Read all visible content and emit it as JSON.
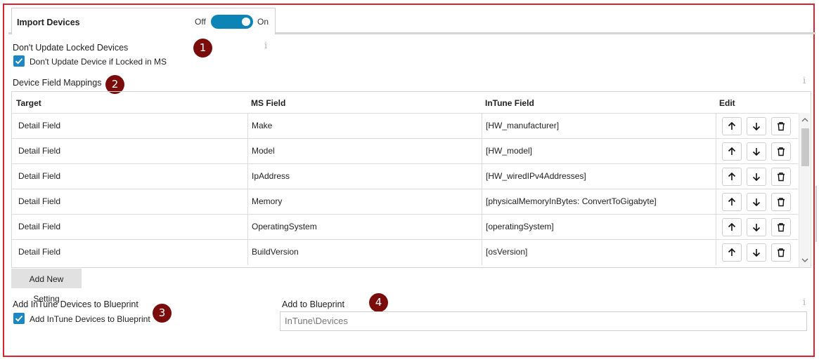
{
  "tab": {
    "title": "Import Devices",
    "toggle_off": "Off",
    "toggle_on": "On"
  },
  "locked": {
    "heading": "Don't Update Locked Devices",
    "checkbox_label": "Don't Update Device if Locked in MS"
  },
  "mappings": {
    "heading": "Device Field Mappings",
    "columns": [
      "Target",
      "MS Field",
      "InTune Field",
      "Edit"
    ],
    "rows": [
      {
        "target": "Detail Field",
        "ms": "Make",
        "intune": "[HW_manufacturer]"
      },
      {
        "target": "Detail Field",
        "ms": "Model",
        "intune": "[HW_model]"
      },
      {
        "target": "Detail Field",
        "ms": "IpAddress",
        "intune": "[HW_wiredIPv4Addresses]"
      },
      {
        "target": "Detail Field",
        "ms": "Memory",
        "intune": "[physicalMemoryInBytes: ConvertToGigabyte]"
      },
      {
        "target": "Detail Field",
        "ms": "OperatingSystem",
        "intune": "[operatingSystem]"
      },
      {
        "target": "Detail Field",
        "ms": "BuildVersion",
        "intune": "[osVersion]"
      }
    ],
    "add_button": "Add New Setting"
  },
  "blueprint": {
    "heading": "Add InTune Devices to Blueprint",
    "checkbox_label": "Add InTune Devices to Blueprint",
    "field_label": "Add to Blueprint",
    "field_value": "InTune\\Devices"
  },
  "markers": [
    "1",
    "2",
    "3",
    "4"
  ],
  "icons": {
    "info": "info-icon",
    "move_up": "arrow-up-icon",
    "move_down": "arrow-down-icon",
    "delete": "trash-icon",
    "check": "check-icon"
  },
  "colors": {
    "accent": "#0c84b5",
    "checkbox": "#1b88c4",
    "frame_border": "#d9232d",
    "marker": "#7a0c0c"
  }
}
